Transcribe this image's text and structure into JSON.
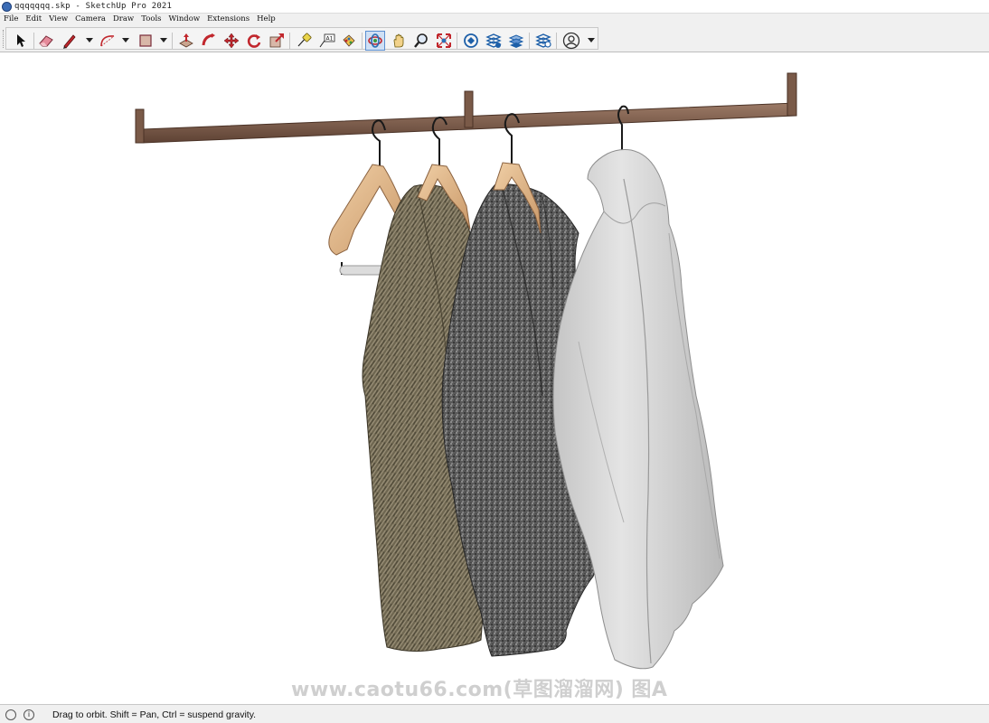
{
  "window": {
    "title": "qqqqqqq.skp - SketchUp Pro 2021"
  },
  "menu": [
    "File",
    "Edit",
    "View",
    "Camera",
    "Draw",
    "Tools",
    "Window",
    "Extensions",
    "Help"
  ],
  "toolbar": {
    "tools": [
      {
        "name": "select-tool",
        "icon": "cursor-arrow-icon"
      },
      {
        "name": "eraser-tool",
        "icon": "eraser-icon"
      },
      {
        "name": "line-tool",
        "icon": "pencil-icon"
      },
      {
        "name": "arc-tool",
        "icon": "arc-icon"
      },
      {
        "name": "shape-tool",
        "icon": "rectangle-icon"
      },
      {
        "name": "push-pull-tool",
        "icon": "push-pull-icon"
      },
      {
        "name": "follow-me-tool",
        "icon": "follow-me-icon"
      },
      {
        "name": "move-tool",
        "icon": "move-icon"
      },
      {
        "name": "rotate-tool",
        "icon": "rotate-icon"
      },
      {
        "name": "scale-tool",
        "icon": "scale-icon"
      },
      {
        "name": "tape-measure-tool",
        "icon": "tape-measure-icon"
      },
      {
        "name": "text-tool",
        "icon": "text-label-icon"
      },
      {
        "name": "paint-bucket-tool",
        "icon": "paint-bucket-icon"
      },
      {
        "name": "orbit-tool",
        "icon": "orbit-icon",
        "active": true
      },
      {
        "name": "pan-tool",
        "icon": "pan-hand-icon"
      },
      {
        "name": "zoom-tool",
        "icon": "magnifier-icon"
      },
      {
        "name": "zoom-extents-tool",
        "icon": "zoom-extents-icon"
      },
      {
        "name": "warehouse-tool",
        "icon": "3d-warehouse-icon"
      },
      {
        "name": "extension-warehouse-tool",
        "icon": "extension-warehouse-icon"
      },
      {
        "name": "layout-tool",
        "icon": "send-to-layout-icon"
      },
      {
        "name": "extension-manager-tool",
        "icon": "extension-manager-icon"
      },
      {
        "name": "account-tool",
        "icon": "user-account-icon"
      }
    ],
    "text_tool_label": "A1"
  },
  "viewport": {
    "watermark": "www.caotu66.com(草图溜溜网) 图A"
  },
  "status": {
    "message": "Drag to orbit. Shift = Pan, Ctrl = suspend gravity."
  },
  "colors": {
    "rail": "#7a5a48",
    "hanger_wood": "#e3b98c",
    "tweed_brown": "#6e6650",
    "tweed_grey": "#5d5d5d",
    "shirt": "#d8d8d8",
    "active_tool": "#cfe0f5"
  }
}
